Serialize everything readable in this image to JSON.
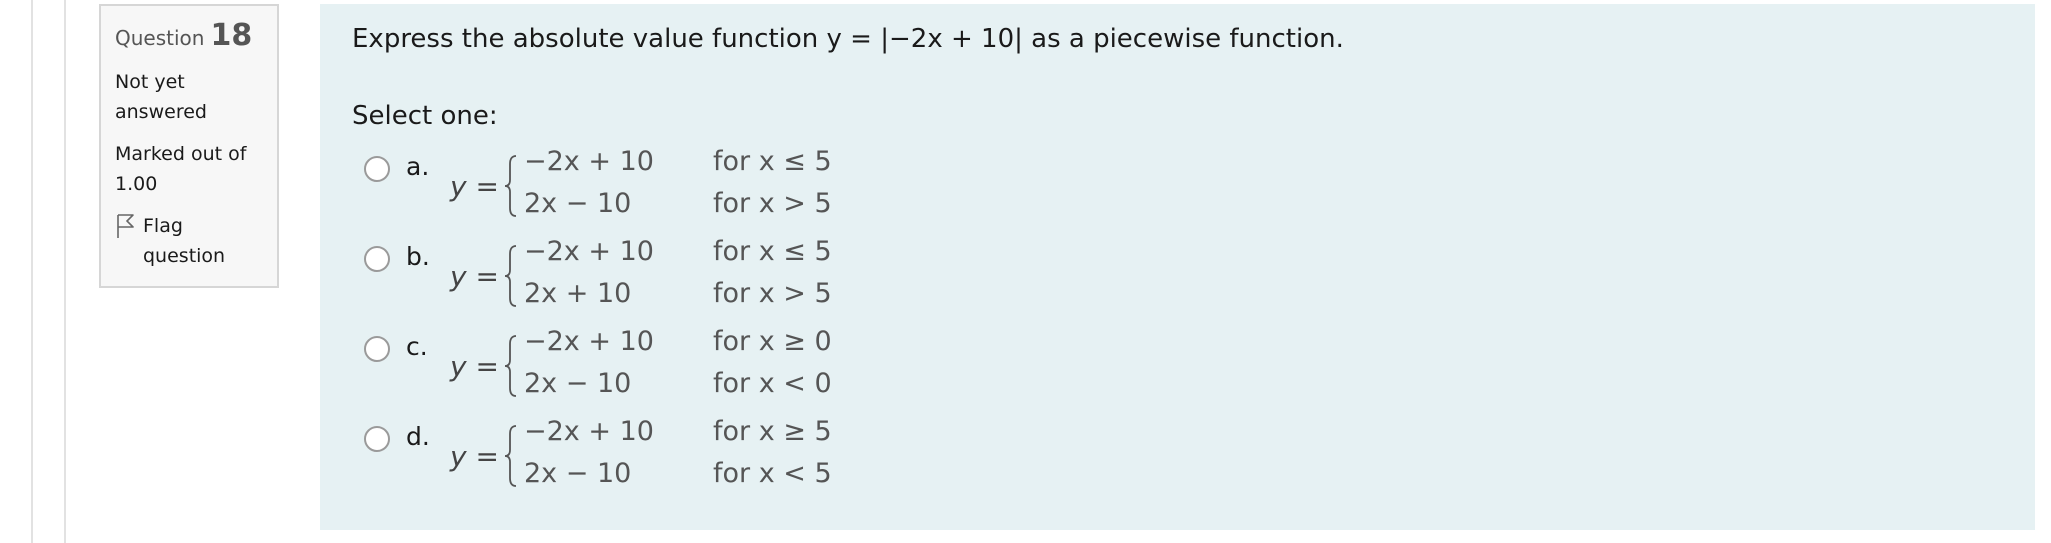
{
  "info": {
    "question_label": "Question",
    "question_number": "18",
    "state_line1": "Not yet",
    "state_line2": "answered",
    "grade_line1": "Marked out of",
    "grade_line2": "1.00",
    "flag_line1": "Flag",
    "flag_line2": "question",
    "flag_icon": "flag-outline-icon"
  },
  "question": {
    "text_before": "Express the absolute value function ",
    "math": "y = |−2x + 10|",
    "text_after": " as a piecewise function.",
    "prompt": "Select one:"
  },
  "answers": [
    {
      "letter": "a.",
      "lhs": "y",
      "eq": " =",
      "top_expr": "−2x + 10",
      "top_cond": "for x ≤ 5",
      "bot_expr": "2x − 10",
      "bot_cond": "for x > 5"
    },
    {
      "letter": "b.",
      "lhs": "y",
      "eq": " =",
      "top_expr": "−2x + 10",
      "top_cond": "for x ≤ 5",
      "bot_expr": "2x + 10",
      "bot_cond": "for x > 5"
    },
    {
      "letter": "c.",
      "lhs": "y",
      "eq": " =",
      "top_expr": "−2x + 10",
      "top_cond": "for x ≥ 0",
      "bot_expr": "2x − 10",
      "bot_cond": "for x < 0"
    },
    {
      "letter": "d.",
      "lhs": "y",
      "eq": " =",
      "top_expr": "−2x + 10",
      "top_cond": "for x ≥ 5",
      "bot_expr": "2x − 10",
      "bot_cond": "for x < 5"
    }
  ],
  "colors": {
    "panel_bg": "#e6f1f3",
    "info_bg": "#f7f7f7",
    "info_border": "#d6d6d6"
  }
}
